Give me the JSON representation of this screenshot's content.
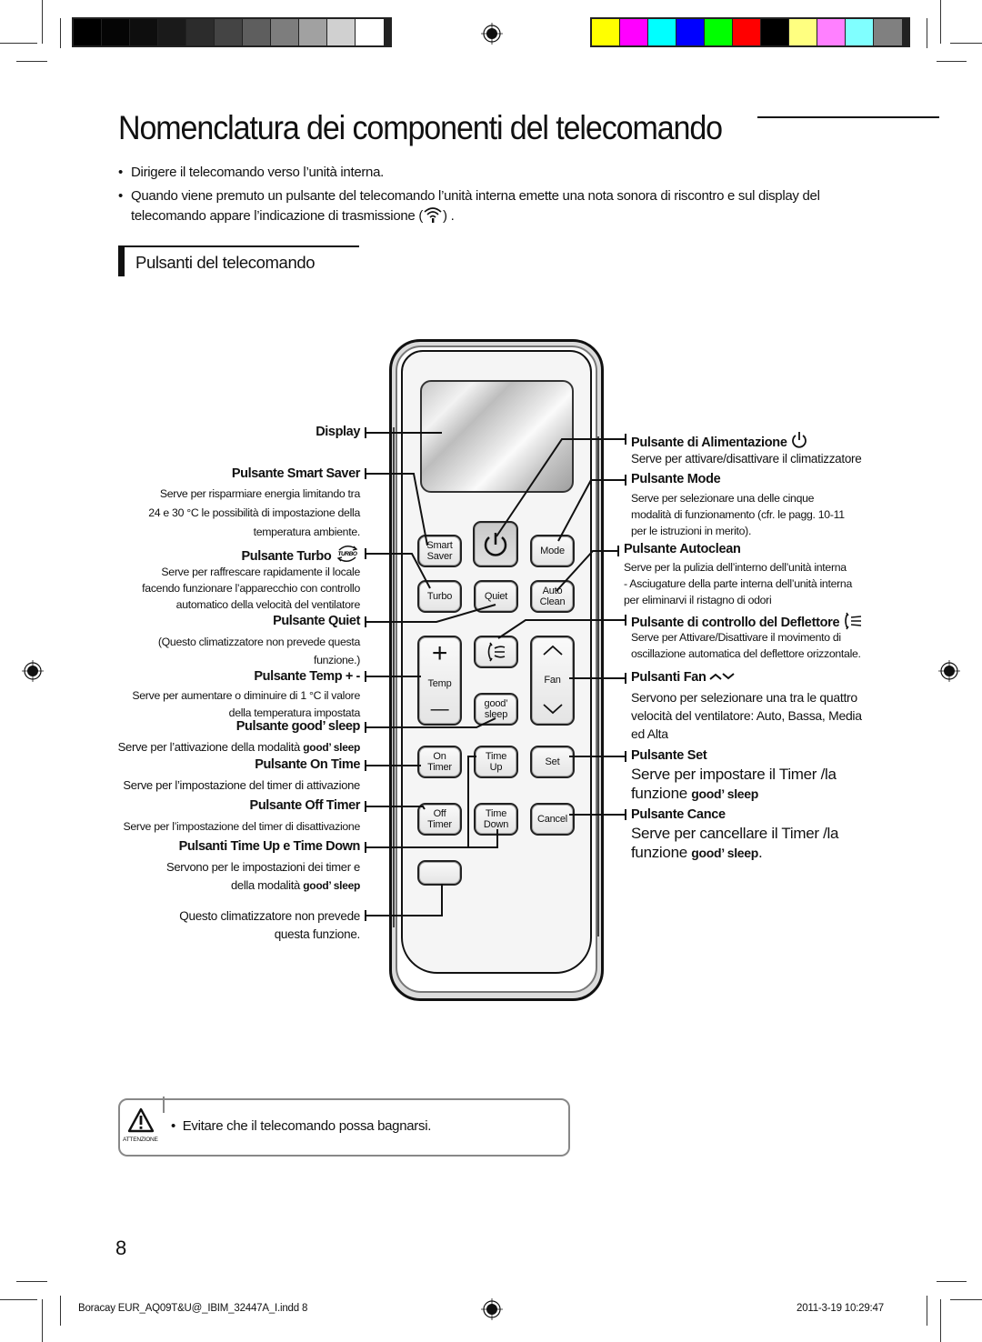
{
  "print_marks": {
    "grayscale_swatches": [
      "#000000",
      "#050505",
      "#0e0e0e",
      "#1a1a1a",
      "#2c2c2c",
      "#444444",
      "#5e5e5e",
      "#7d7d7d",
      "#a1a1a1",
      "#d0d0d0",
      "#ffffff"
    ],
    "color_swatches": [
      "#ffff00",
      "#ff00ff",
      "#00ffff",
      "#0000ff",
      "#00ff00",
      "#ff0000",
      "#000000",
      "#ffff80",
      "#ff80ff",
      "#80ffff",
      "#808080"
    ]
  },
  "page": {
    "title": "Nomenclatura dei componenti del telecomando",
    "intro": [
      "Dirigere il telecomando verso l’unità interna.",
      "Quando  viene premuto un pulsante del telecomando l’unità interna emette una nota sonora di riscontro e sul display del",
      "telecomando appare l’indicazione di trasmissione (",
      ") ."
    ],
    "bullet": "•",
    "section_title": "Pulsanti del telecomando"
  },
  "remote": {
    "buttons": {
      "smart_saver": [
        "Smart",
        "Saver"
      ],
      "mode": "Mode",
      "turbo": "Turbo",
      "quiet": "Quiet",
      "auto_clean": [
        "Auto",
        "Clean"
      ],
      "temp_plus": "+",
      "temp": "Temp",
      "temp_minus": "—",
      "good_sleep": [
        "good’",
        "sleep"
      ],
      "fan": "Fan",
      "on_timer": [
        "On",
        "Timer"
      ],
      "time_up": [
        "Time",
        "Up"
      ],
      "set": "Set",
      "off_timer": [
        "Off",
        "Timer"
      ],
      "time_down": [
        "Time",
        "Down"
      ],
      "cancel": "Cancel"
    }
  },
  "labels_left": {
    "display": "Display",
    "smart_saver": {
      "title": "Pulsante Smart Saver",
      "desc": [
        "Serve per risparmiare energia limitando tra",
        "24 e 30 °C le possibilità di impostazione della",
        "temperatura ambiente."
      ]
    },
    "turbo": {
      "title": "Pulsante Turbo",
      "icon_text": "TURBO",
      "desc": [
        "Serve per raffrescare rapidamente il locale",
        "facendo funzionare   l’apparecchio con controllo",
        "automatico della velocità del ventilatore"
      ]
    },
    "quiet": {
      "title": "Pulsante Quiet",
      "desc": [
        "(Questo climatizzatore non prevede questa",
        "funzione.)"
      ]
    },
    "temp": {
      "title": "Pulsante Temp + -",
      "desc": [
        "Serve per aumentare o diminuire di 1 °C il valore",
        "della temperatura impostata"
      ]
    },
    "good_sleep": {
      "title_pre": "Pulsante ",
      "title_brand": "good’ sleep",
      "desc_pre": "Serve per l’attivazione della modalità ",
      "desc_brand": "good’ sleep"
    },
    "on_time": {
      "title": "Pulsante On Time",
      "desc": "Serve per l’impostazione del timer di attivazione"
    },
    "off_timer": {
      "title": "Pulsante Off Timer",
      "desc": "Serve per l’impostazione del timer di disattivazione"
    },
    "time_up_down": {
      "title": "Pulsanti Time Up e Time Down",
      "desc1": "Servono per le impostazioni dei timer  e",
      "desc2_pre": "della modalità ",
      "desc2_brand": "good’ sleep"
    },
    "unused": [
      "Questo climatizzatore non prevede",
      "questa funzione."
    ]
  },
  "labels_right": {
    "power": {
      "title": "Pulsante di Alimentazione",
      "desc": "Serve per attivare/disattivare il climatizzatore"
    },
    "mode": {
      "title": "Pulsante Mode",
      "desc": [
        "Serve per selezionare una delle cinque",
        "modalità di funzionamento (cfr. le pagg. 10-11",
        "per le istruzioni in merito)."
      ]
    },
    "autoclean": {
      "title": "Pulsante Autoclean",
      "desc": [
        "Serve per la pulizia dell’interno dell’unità interna",
        "- Asciugature della parte interna dell’unità interna",
        "per eliminarvi il ristagno di odori"
      ]
    },
    "deflector": {
      "title": "Pulsante di controllo del Deflettore",
      "desc": [
        "Serve per Attivare/Disattivare il movimento di",
        "oscillazione automatica del deflettore orizzontale."
      ]
    },
    "fan": {
      "title": "Pulsanti Fan",
      "desc": [
        "Servono per selezionare una tra le quattro",
        "velocità del ventilatore: Auto, Bassa, Media",
        "ed Alta"
      ]
    },
    "set": {
      "title": "Pulsante Set",
      "desc1": "Serve per impostare il Timer /la",
      "desc2_pre": "funzione ",
      "desc2_brand": "good’ sleep"
    },
    "cancel": {
      "title": "Pulsante Cance",
      "desc1": "Serve per cancellare il Timer /la",
      "desc2_pre": "funzione ",
      "desc2_brand": "good’ sleep",
      "desc2_post": "."
    }
  },
  "caution": {
    "label": "ATTENZIONE",
    "text": "Evitare che il telecomando possa bagnarsi."
  },
  "footer": {
    "page_number": "8",
    "file": "Boracay EUR_AQ09T&U@_IBIM_32447A_I.indd   8",
    "date": "2011-3-19   10:29:47"
  }
}
